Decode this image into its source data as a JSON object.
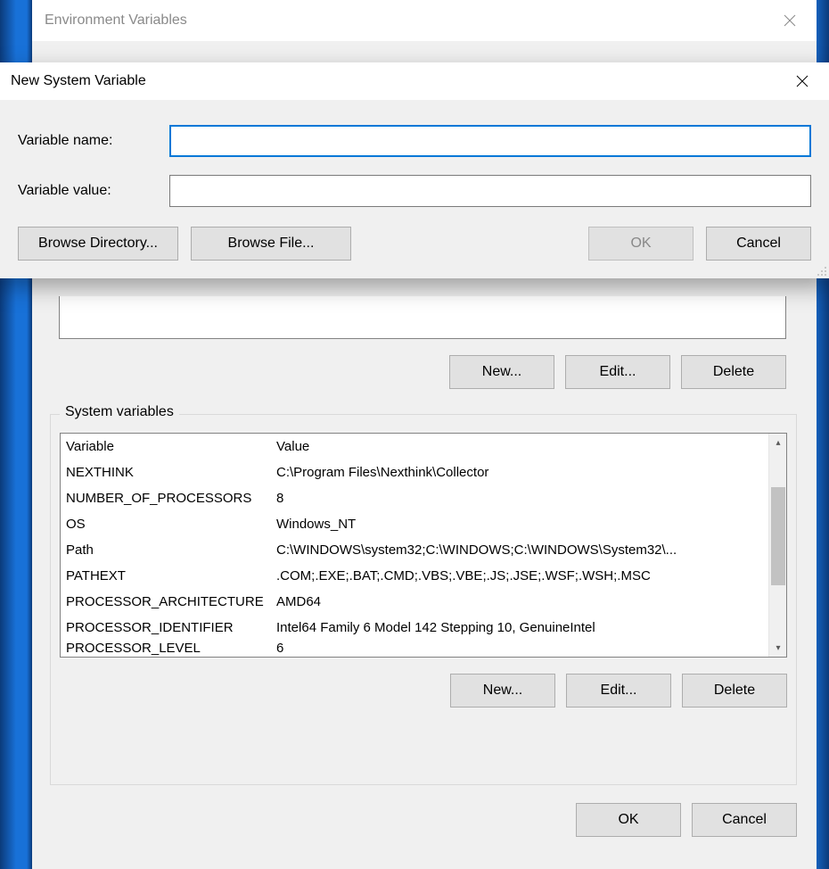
{
  "env_dialog": {
    "title": "Environment Variables",
    "user_buttons": {
      "new": "New...",
      "edit": "Edit...",
      "delete": "Delete"
    },
    "system_label": "System variables",
    "system_columns": {
      "variable": "Variable",
      "value": "Value"
    },
    "system_rows": [
      {
        "variable": "NEXTHINK",
        "value": "C:\\Program Files\\Nexthink\\Collector"
      },
      {
        "variable": "NUMBER_OF_PROCESSORS",
        "value": "8"
      },
      {
        "variable": "OS",
        "value": "Windows_NT"
      },
      {
        "variable": "Path",
        "value": "C:\\WINDOWS\\system32;C:\\WINDOWS;C:\\WINDOWS\\System32\\..."
      },
      {
        "variable": "PATHEXT",
        "value": ".COM;.EXE;.BAT;.CMD;.VBS;.VBE;.JS;.JSE;.WSF;.WSH;.MSC"
      },
      {
        "variable": "PROCESSOR_ARCHITECTURE",
        "value": "AMD64"
      },
      {
        "variable": "PROCESSOR_IDENTIFIER",
        "value": "Intel64 Family 6 Model 142 Stepping 10, GenuineIntel"
      },
      {
        "variable": "PROCESSOR_LEVEL",
        "value": "6"
      }
    ],
    "system_buttons": {
      "new": "New...",
      "edit": "Edit...",
      "delete": "Delete"
    },
    "bottom": {
      "ok": "OK",
      "cancel": "Cancel"
    }
  },
  "new_dialog": {
    "title": "New System Variable",
    "labels": {
      "name": "Variable name:",
      "value": "Variable value:"
    },
    "fields": {
      "name": "",
      "value": ""
    },
    "buttons": {
      "browse_dir": "Browse Directory...",
      "browse_file": "Browse File...",
      "ok": "OK",
      "cancel": "Cancel"
    }
  }
}
